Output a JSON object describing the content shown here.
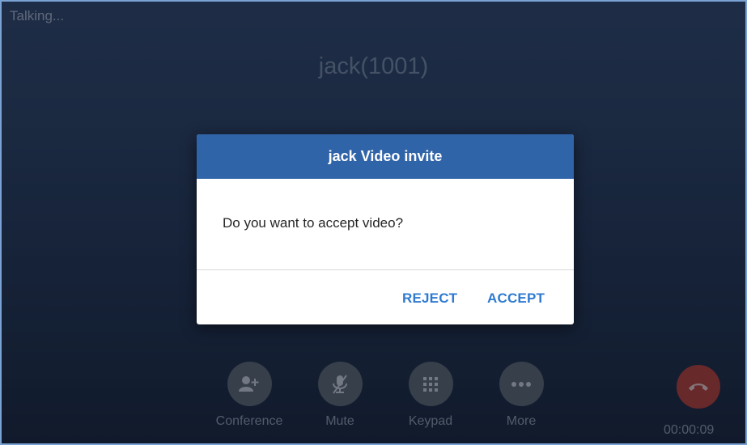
{
  "call": {
    "status": "Talking...",
    "caller": "jack(1001)",
    "duration": "00:00:09"
  },
  "dialog": {
    "title": "jack Video invite",
    "message": "Do you want to accept video?",
    "reject_label": "REJECT",
    "accept_label": "ACCEPT"
  },
  "actions": [
    {
      "label": "Conference",
      "icon": "add-person-icon"
    },
    {
      "label": "Mute",
      "icon": "mic-off-icon"
    },
    {
      "label": "Keypad",
      "icon": "keypad-icon"
    },
    {
      "label": "More",
      "icon": "more-dots-icon"
    }
  ],
  "end_call": {
    "icon": "end-call-icon"
  },
  "colors": {
    "dialog_header": "#3064a8",
    "dialog_button": "#2e7ad1",
    "end_call": "#b53c36",
    "action_circle": "#5c6470"
  }
}
